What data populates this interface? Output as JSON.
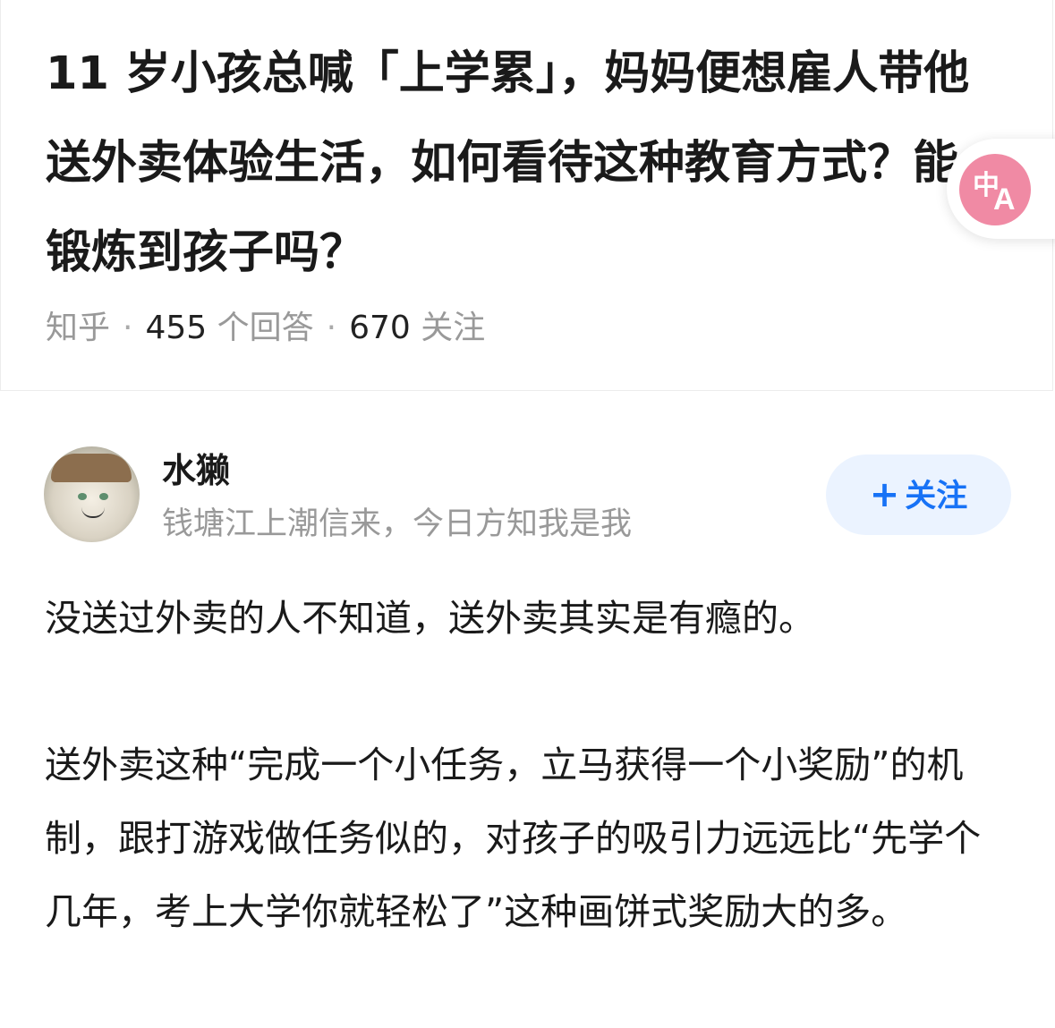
{
  "question": {
    "title": "11 岁小孩总喊「上学累」，妈妈便想雇人带他送外卖体验生活，如何看待这种教育方式？能锻炼到孩子吗？",
    "source": "知乎",
    "answers_count": "455",
    "answers_label": "个回答",
    "followers_count": "670",
    "followers_label": "关注",
    "separator": "·"
  },
  "translate_button": {
    "icon": "translate-icon",
    "zh_glyph": "中",
    "a_glyph": "A",
    "color": "#f08aa4"
  },
  "author": {
    "name": "水獭",
    "bio": "钱塘江上潮信来，今日方知我是我",
    "avatar_icon": "cat-avatar"
  },
  "follow_button": {
    "plus": "+",
    "label": "关注",
    "color": "#1772f6"
  },
  "answer": {
    "paragraphs": [
      "没送过外卖的人不知道，送外卖其实是有瘾的。",
      "送外卖这种“完成一个小任务，立马获得一个小奖励”的机制，跟打游戏做任务似的，对孩子的吸引力远远比“先学个几年，考上大学你就轻松了”这种画饼式奖励大的多。"
    ]
  }
}
